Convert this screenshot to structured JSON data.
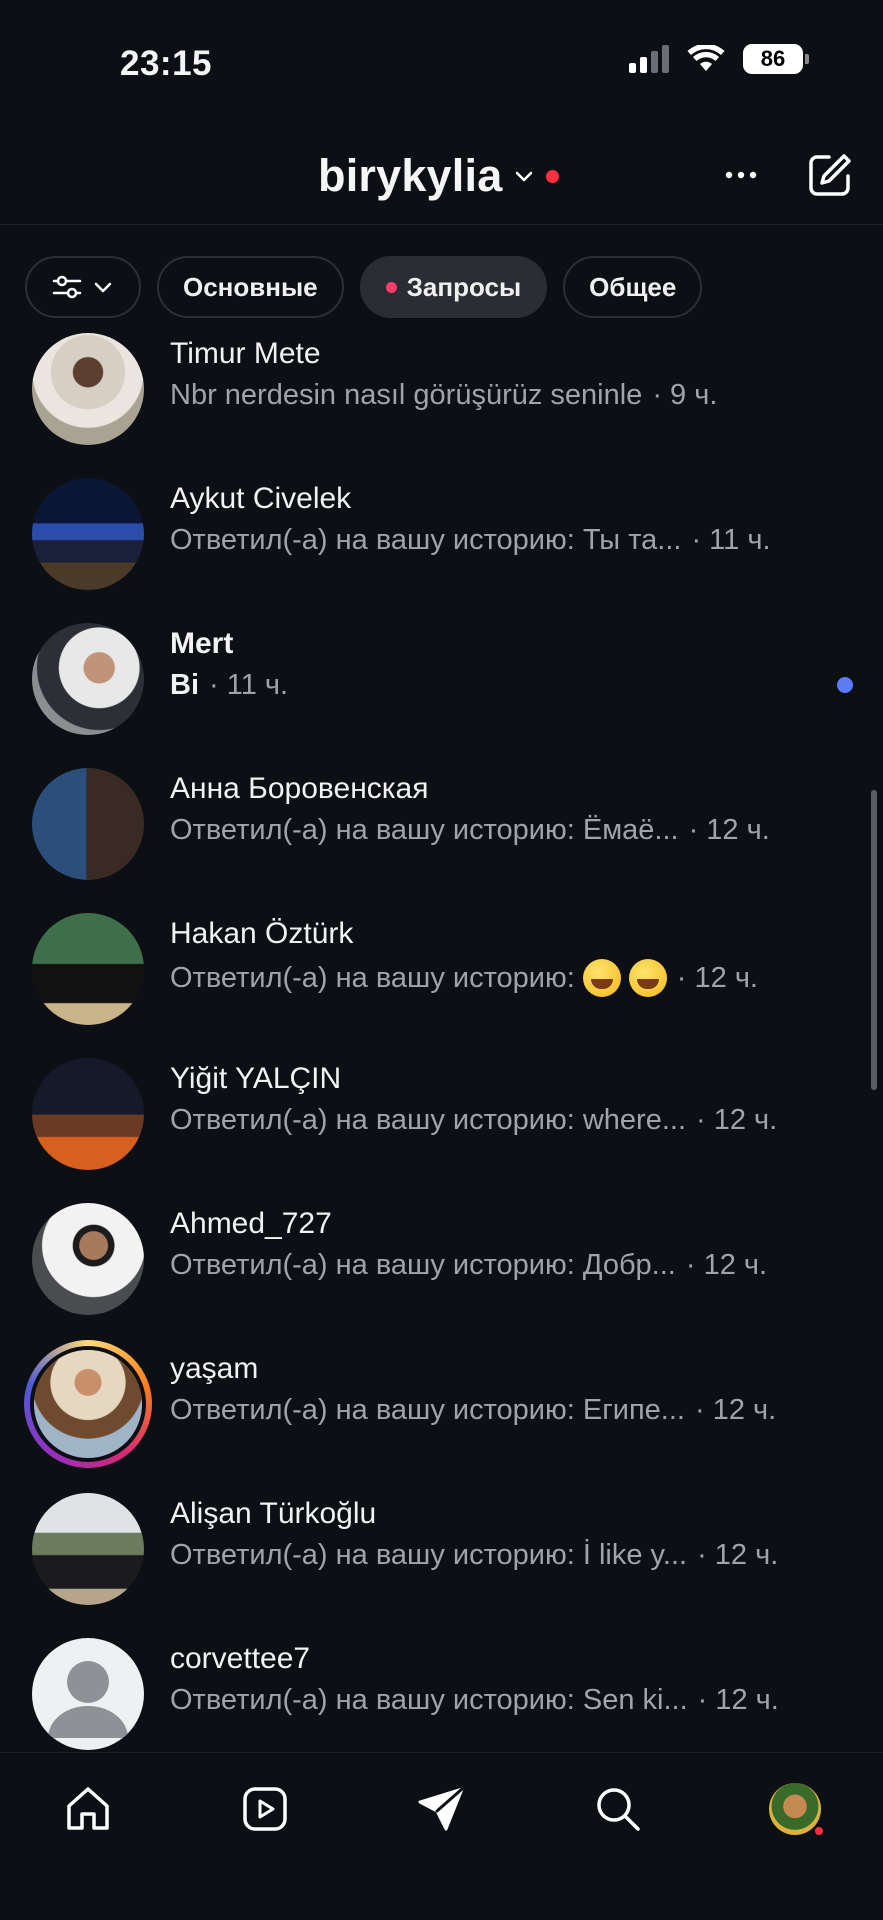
{
  "status_bar": {
    "time": "23:15",
    "battery": "86"
  },
  "header": {
    "account_name": "birykylia"
  },
  "chips": [
    {
      "label": "Основные"
    },
    {
      "label": "Запросы"
    },
    {
      "label": "Общее"
    }
  ],
  "messages": [
    {
      "name": "Timur Mete",
      "preview": "Nbr nerdesin nasıl görüşürüz seninle",
      "time": "· 9 ч."
    },
    {
      "name": "Aykut Civelek",
      "preview": "Ответил(-а) на вашу историю: Ты та...",
      "time": "· 11 ч."
    },
    {
      "name": "Mert",
      "preview": "Bi",
      "time": "· 11 ч."
    },
    {
      "name": "Анна Боровенская",
      "preview": "Ответил(-а) на вашу историю: Ёмаё...",
      "time": "· 12 ч."
    },
    {
      "name": "Hakan Öztürk",
      "preview": "Ответил(-а) на вашу историю:",
      "time": "· 12 ч."
    },
    {
      "name": "Yiğit YALÇIN",
      "preview": "Ответил(-а) на вашу историю: where...",
      "time": "· 12 ч."
    },
    {
      "name": "Ahmed_727",
      "preview": "Ответил(-а) на вашу историю: Добр...",
      "time": "· 12 ч."
    },
    {
      "name": "yaşam",
      "preview": "Ответил(-а) на вашу историю: Египе...",
      "time": "· 12 ч."
    },
    {
      "name": "Alişan Türkoğlu",
      "preview": "Ответил(-а) на вашу историю: İ like y...",
      "time": "· 12 ч."
    },
    {
      "name": "corvettee7",
      "preview": "Ответил(-а) на вашу историю: Sen ki...",
      "time": "· 12 ч."
    }
  ],
  "icons": {
    "header": [
      "chevron-down-icon",
      "more-icon",
      "compose-icon"
    ],
    "nav": [
      "home-icon",
      "reels-icon",
      "direct-icon",
      "search-icon",
      "profile-avatar"
    ]
  },
  "colors": {
    "background": "#0c0f14",
    "unread_dot": "#5b7cf7",
    "notification_dot": "#ff3040",
    "chip_dot": "#ff3b6b"
  }
}
